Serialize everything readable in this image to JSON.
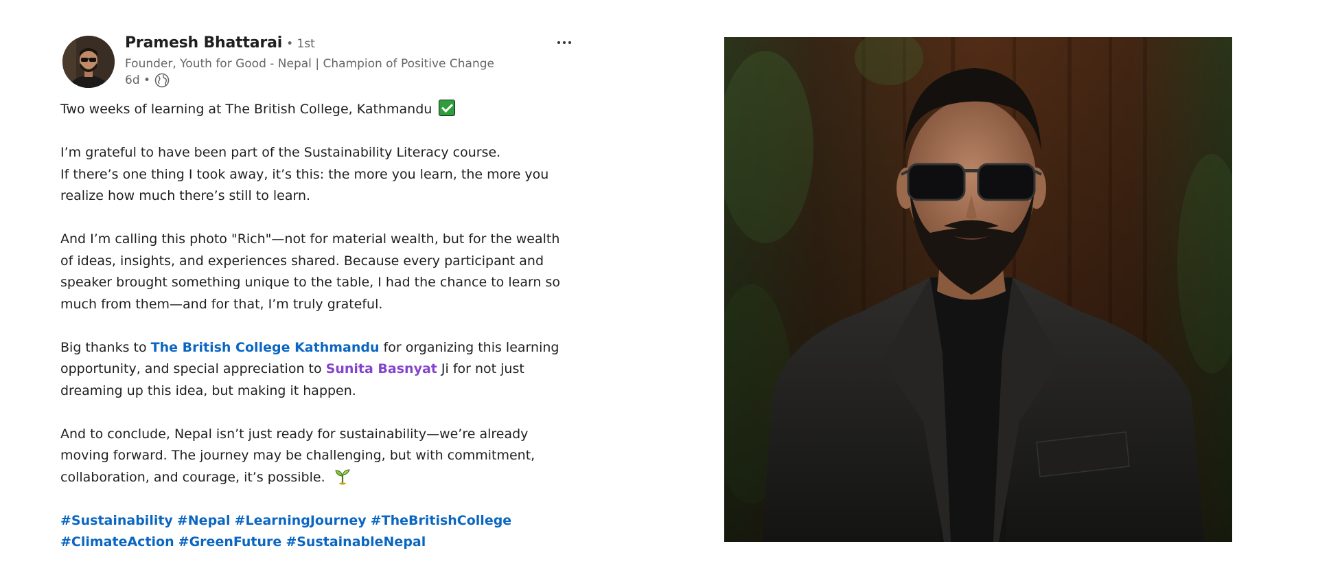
{
  "post": {
    "author": {
      "name": "Pramesh Bhattarai",
      "degree": "• 1st",
      "headline": "Founder, Youth for Good - Nepal | Champion of Positive Change",
      "time": "6d •",
      "visibility_icon": "globe-icon",
      "avatar_icon": "avatar"
    },
    "more_icon": "more-options-icon",
    "body": {
      "p1": "Two weeks of learning at The British College, Kathmandu",
      "p1_emoji": "check-mark-button-emoji",
      "p2_l1": "I’m grateful to have been part of the Sustainability Literacy course.",
      "p2_l2": "If there’s one thing I took away, it’s this: the more you learn, the more you",
      "p2_l3": "realize how much there’s still to learn.",
      "p3_l1": "And I’m calling this photo \"Rich\"—not for material wealth, but for the wealth",
      "p3_l2": "of ideas, insights, and experiences shared. Because every participant and",
      "p3_l3": "speaker brought something unique to the table, I had the chance to learn so",
      "p3_l4": "much from them—and for that, I’m truly grateful.",
      "p4_pre": "Big thanks to ",
      "p4_org": "The British College Kathmandu",
      "p4_post": " for organizing this learning",
      "p4_l2_pre": "opportunity, and special appreciation to ",
      "p4_person": "Sunita Basnyat",
      "p4_l2_post": " Ji for not just",
      "p4_l3": "dreaming up this idea, but making it happen.",
      "p5_l1": "And to conclude, Nepal isn’t just ready for sustainability—we’re already",
      "p5_l2": "moving forward. The journey may be challenging, but with commitment,",
      "p5_l3": "collaboration, and courage, it’s possible.",
      "p5_emoji": "seedling-emoji"
    },
    "hashtags_row1": [
      "#Sustainability",
      "#Nepal",
      "#LearningJourney",
      "#TheBritishCollege"
    ],
    "hashtags_row2": [
      "#ClimateAction",
      "#GreenFuture",
      "#SustainableNepal"
    ]
  },
  "photo": {
    "subject": "post-photo"
  },
  "colors": {
    "link_blue": "#0a66c2",
    "mention_purple": "#8344cc",
    "text": "#1f1f1f",
    "muted": "#666666"
  }
}
